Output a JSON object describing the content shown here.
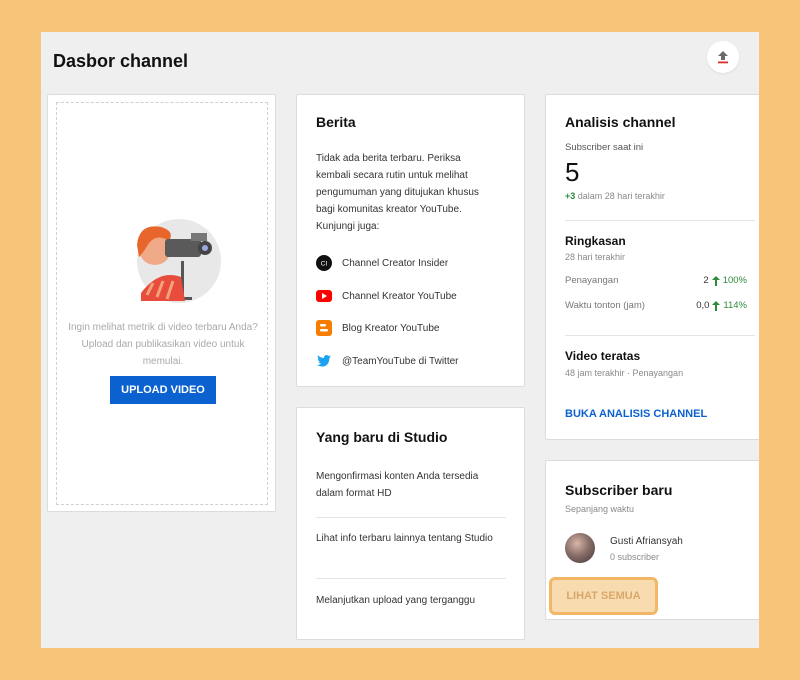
{
  "header": {
    "title": "Dasbor channel",
    "upload_icon": "upload-icon"
  },
  "video_card": {
    "message": "Ingin melihat metrik di video terbaru Anda? Upload dan publikasikan video untuk memulai.",
    "button_label": "UPLOAD VIDEO"
  },
  "news": {
    "title": "Berita",
    "body": "Tidak ada berita terbaru. Periksa kembali secara rutin untuk melihat pengumuman yang ditujukan khusus bagi komunitas kreator YouTube. Kunjungi juga:",
    "items": [
      {
        "label": "Channel Creator Insider",
        "icon": "creator-insider-icon",
        "icon_text": "CI"
      },
      {
        "label": "Channel Kreator YouTube",
        "icon": "youtube-icon"
      },
      {
        "label": "Blog Kreator YouTube",
        "icon": "blogger-icon"
      },
      {
        "label": "@TeamYouTube di Twitter",
        "icon": "twitter-icon"
      }
    ]
  },
  "studio": {
    "title": "Yang baru di Studio",
    "items": [
      "Mengonfirmasi konten Anda tersedia dalam format HD",
      "Lihat info terbaru lainnya tentang Studio",
      "Melanjutkan upload yang terganggu"
    ]
  },
  "analytics": {
    "title": "Analisis channel",
    "subscriber_label": "Subscriber saat ini",
    "subscriber_count": "5",
    "subscriber_delta": "+3",
    "subscriber_delta_text": "dalam 28 hari terakhir",
    "summary_title": "Ringkasan",
    "summary_period": "28 hari terakhir",
    "rows": [
      {
        "label": "Penayangan",
        "value": "2",
        "change": "100%"
      },
      {
        "label": "Waktu tonton (jam)",
        "value": "0,0",
        "change": "114%"
      }
    ],
    "top_videos_title": "Video teratas",
    "top_videos_sub": "48 jam terakhir · Penayangan",
    "link_label": "BUKA ANALISIS CHANNEL"
  },
  "subscribers": {
    "title": "Subscriber baru",
    "period": "Sepanjang waktu",
    "user_name": "Gusti Afriansyah",
    "user_subs": "0 subscriber",
    "see_all_label": "LIHAT SEMUA"
  },
  "colors": {
    "primary": "#0b61d0",
    "green": "#2e8b3a",
    "highlight": "#f2b766",
    "background": "#f7c57a"
  }
}
